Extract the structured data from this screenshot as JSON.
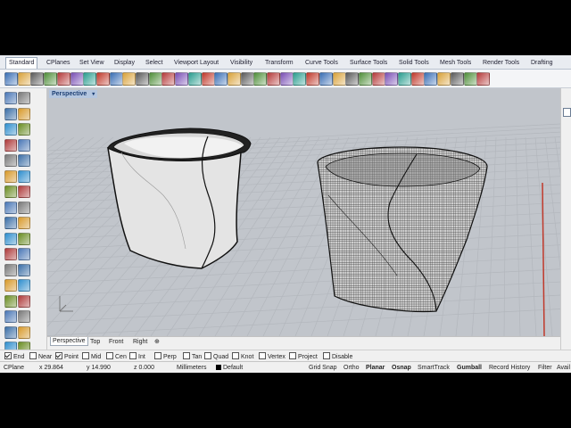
{
  "ribbon": {
    "tabs": [
      "Standard",
      "CPlanes",
      "Set View",
      "Display",
      "Select",
      "Viewport Layout",
      "Visibility",
      "Transform",
      "Curve Tools",
      "Surface Tools",
      "Solid Tools",
      "Mesh Tools",
      "Render Tools",
      "Drafting"
    ],
    "active_tab": "Standard"
  },
  "toolbar": {
    "icons": [
      "new-icon",
      "open-icon",
      "save-icon",
      "print-icon",
      "import-icon",
      "cut-icon",
      "copy-icon",
      "paste-icon",
      "undo-icon",
      "redo-icon",
      "pan-icon",
      "rotate-view-icon",
      "zoom-icon",
      "zoom-window-icon",
      "zoom-extents-icon",
      "zoom-selected-icon",
      "zoom-region-icon",
      "move-icon",
      "car-icon",
      "viewport-icon",
      "layout-icon",
      "four-view-icon",
      "cplane-icon",
      "grid-icon",
      "layers-icon",
      "light-icon",
      "material-icon",
      "render-icon",
      "display-mode-icon",
      "sphere-icon",
      "shaded-sphere-icon",
      "shaded-sphere-2-icon",
      "environment-icon",
      "light-bulb-icon",
      "object-properties-icon",
      "options-icon",
      "help-icon"
    ]
  },
  "left_toolbar": {
    "rows": 17
  },
  "viewport": {
    "title": "Perspective",
    "menu_arrow": "▾",
    "background": "#c1c5cb"
  },
  "viewport_tabs": [
    "Perspective",
    "Top",
    "Front",
    "Right"
  ],
  "viewport_tabs_add": "⊕",
  "osnaps": [
    {
      "label": "End",
      "checked": true
    },
    {
      "label": "Near",
      "checked": false
    },
    {
      "label": "Point",
      "checked": true
    },
    {
      "label": "Mid",
      "checked": false
    },
    {
      "label": "Cen",
      "checked": false
    },
    {
      "label": "Int",
      "checked": false
    },
    {
      "label": "Perp",
      "checked": false
    },
    {
      "label": "Tan",
      "checked": false
    },
    {
      "label": "Quad",
      "checked": false
    },
    {
      "label": "Knot",
      "checked": false
    },
    {
      "label": "Vertex",
      "checked": false
    },
    {
      "label": "Project",
      "checked": false
    },
    {
      "label": "Disable",
      "checked": false
    }
  ],
  "status": {
    "cplane": "CPlane",
    "x": "x 29.864",
    "y": "y 14.990",
    "z": "z 0.000",
    "units": "Millimeters",
    "layer": "Default",
    "grid_snap": "Grid Snap",
    "ortho": "Ortho",
    "planar": "Planar",
    "osnap": "Osnap",
    "smarttrack": "SmartTrack",
    "gumball": "Gumball",
    "record_history": "Record History",
    "filter": "Filter",
    "avail": "Avail"
  },
  "colors": {
    "axis_red": "#c0392b",
    "grid_line": "#b3b7bd",
    "viewport_title_bg": "#b4c6df"
  }
}
